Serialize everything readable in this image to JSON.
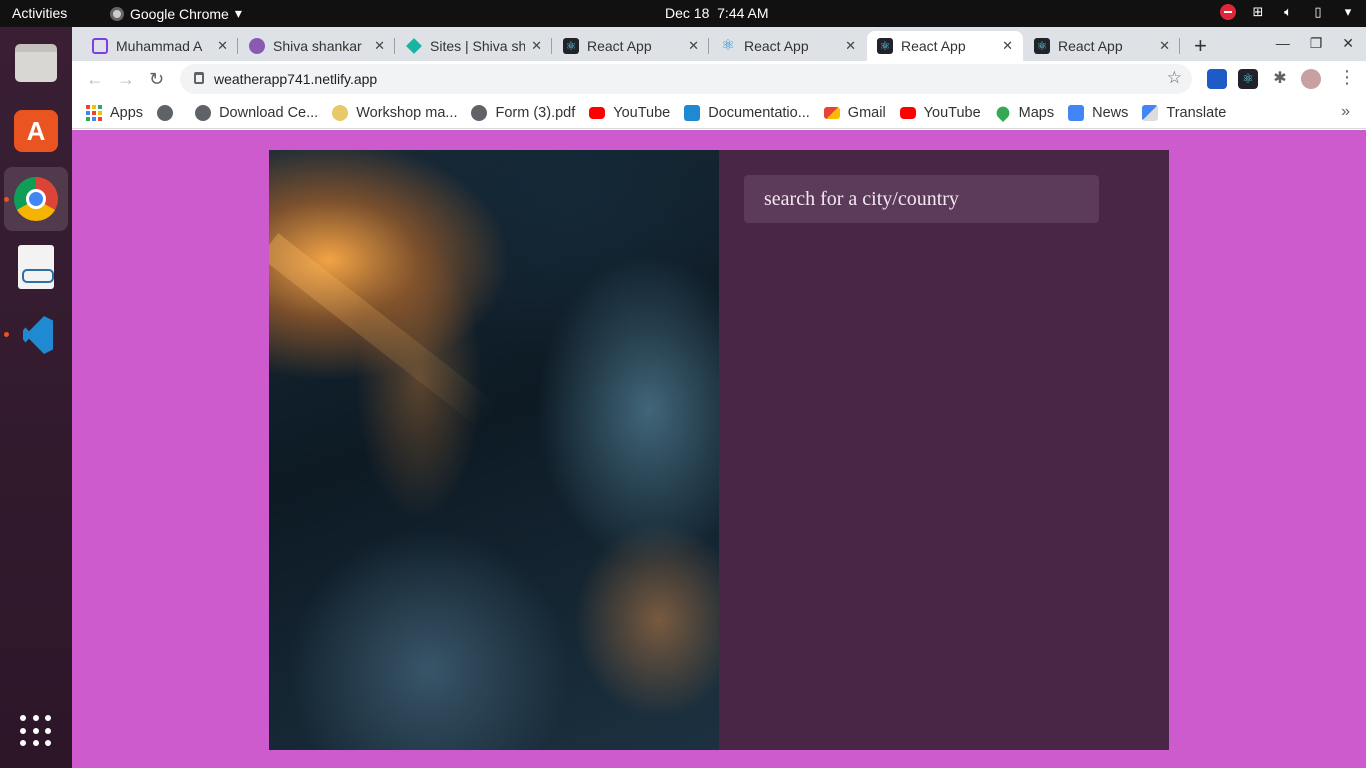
{
  "topbar": {
    "activities": "Activities",
    "app_name": "Google Chrome",
    "date": "Dec 18",
    "time": "7:44 AM"
  },
  "tabs": [
    {
      "title": "Muhammad A",
      "favicon": "chart-icon"
    },
    {
      "title": "Shiva shankar",
      "favicon": "avatar-icon"
    },
    {
      "title": "Sites | Shiva sh",
      "favicon": "sites-icon"
    },
    {
      "title": "React App",
      "favicon": "react-icon"
    },
    {
      "title": "React App",
      "favicon": "react-icon"
    },
    {
      "title": "React App",
      "favicon": "react-icon",
      "active": true
    },
    {
      "title": "React App",
      "favicon": "react-icon"
    }
  ],
  "toolbar": {
    "url": "weatherapp741.netlify.app"
  },
  "bookmarks": [
    {
      "label": "Apps",
      "icon": "apps-grid-icon"
    },
    {
      "label": "",
      "icon": "globe-icon"
    },
    {
      "label": "Download Ce...",
      "icon": "globe-icon"
    },
    {
      "label": "Workshop ma...",
      "icon": "workshop-icon"
    },
    {
      "label": "Form (3).pdf",
      "icon": "globe-icon"
    },
    {
      "label": "YouTube",
      "icon": "youtube-icon"
    },
    {
      "label": "Documentatio...",
      "icon": "vscode-icon"
    },
    {
      "label": "Gmail",
      "icon": "gmail-icon"
    },
    {
      "label": "YouTube",
      "icon": "youtube-icon"
    },
    {
      "label": "Maps",
      "icon": "maps-icon"
    },
    {
      "label": "News",
      "icon": "news-icon"
    },
    {
      "label": "Translate",
      "icon": "translate-icon"
    }
  ],
  "page": {
    "search_placeholder": "search for a city/country",
    "background_color": "#cd5bcd",
    "panel_color": "#4a2646"
  }
}
